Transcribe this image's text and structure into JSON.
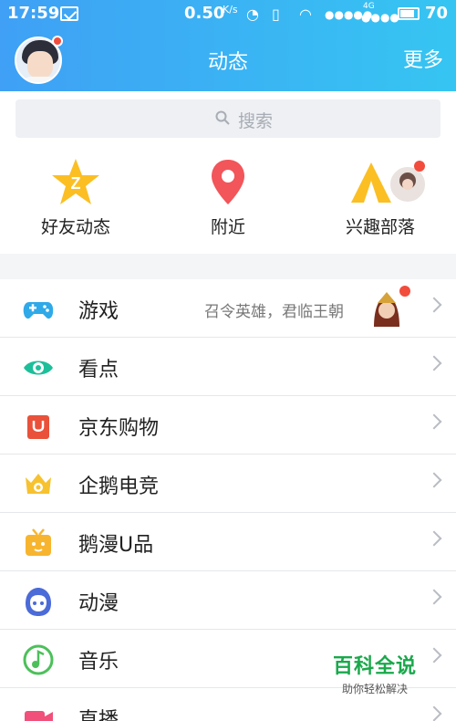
{
  "status_bar": {
    "time": "17:59",
    "net_speed": "0.50",
    "net_speed_unit": "K/s",
    "network": "4G",
    "battery": "70"
  },
  "header": {
    "title": "动态",
    "more": "更多"
  },
  "search": {
    "placeholder": "搜索"
  },
  "quick_links": [
    {
      "label": "好友动态",
      "icon": "qzone-star-icon"
    },
    {
      "label": "附近",
      "icon": "location-pin-icon"
    },
    {
      "label": "兴趣部落",
      "icon": "tribe-tent-icon"
    }
  ],
  "menu": [
    {
      "label": "游戏",
      "subtitle": "召令英雄，君临王朝",
      "icon": "gamepad-icon"
    },
    {
      "label": "看点",
      "icon": "eye-icon"
    },
    {
      "label": "京东购物",
      "icon": "jd-bag-icon"
    },
    {
      "label": "企鹅电竞",
      "icon": "esports-crown-icon"
    },
    {
      "label": "鹅漫U品",
      "icon": "tv-box-icon"
    },
    {
      "label": "动漫",
      "icon": "anime-face-icon"
    },
    {
      "label": "音乐",
      "icon": "music-note-icon"
    },
    {
      "label": "直播",
      "icon": "video-camera-icon"
    }
  ],
  "watermark": {
    "title": "百科全说",
    "subtitle": "助你轻松解决"
  },
  "colors": {
    "header_start": "#3fa0f5",
    "header_end": "#36c5f2",
    "badge": "#f24c3d"
  }
}
